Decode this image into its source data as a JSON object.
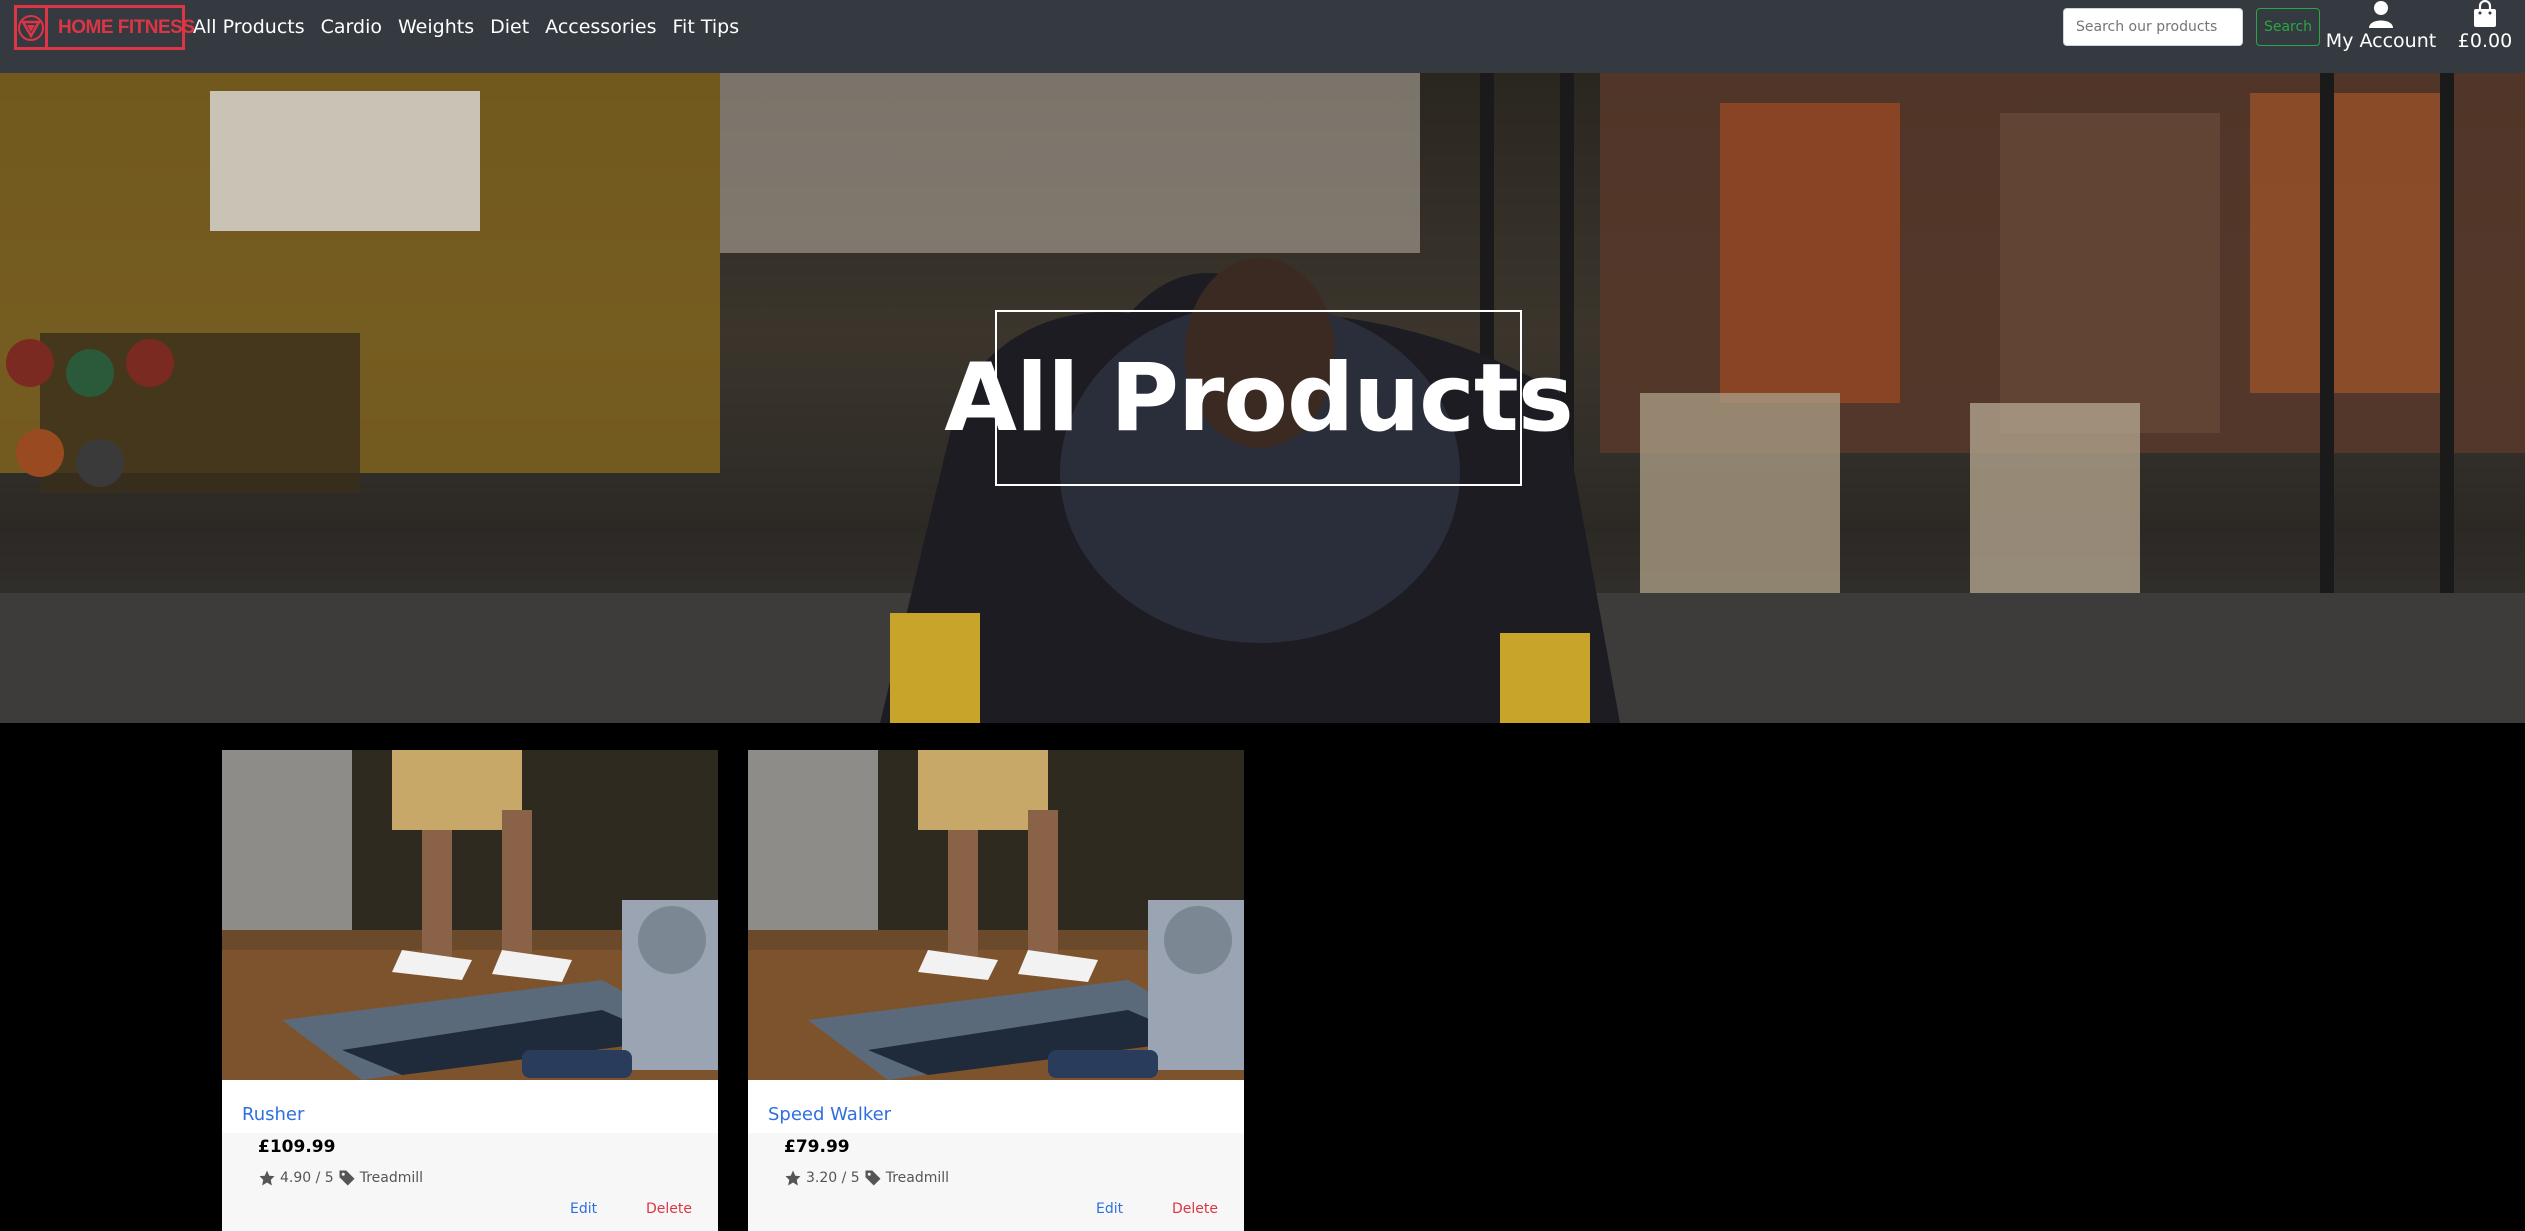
{
  "brand": {
    "name": "HOME FITNESS",
    "color": "#dc3545"
  },
  "nav": {
    "links": [
      "All Products",
      "Cardio",
      "Weights",
      "Diet",
      "Accessories",
      "Fit Tips"
    ]
  },
  "search": {
    "placeholder": "Search our products",
    "button_label": "Search"
  },
  "account": {
    "label": "My Account",
    "icon": "user-icon"
  },
  "bag": {
    "total": "£0.00",
    "icon": "shopping-bag-icon"
  },
  "hero": {
    "title": "All Products"
  },
  "products": [
    {
      "name": "Rusher",
      "price": "£109.99",
      "rating": "4.90 / 5",
      "category": "Treadmill",
      "edit_label": "Edit",
      "delete_label": "Delete"
    },
    {
      "name": "Speed Walker",
      "price": "£79.99",
      "rating": "3.20 / 5",
      "category": "Treadmill",
      "edit_label": "Edit",
      "delete_label": "Delete"
    }
  ],
  "colors": {
    "navbar": "#343a40",
    "link": "#2f6fe0",
    "danger": "#dc3545",
    "success": "#28a745"
  }
}
